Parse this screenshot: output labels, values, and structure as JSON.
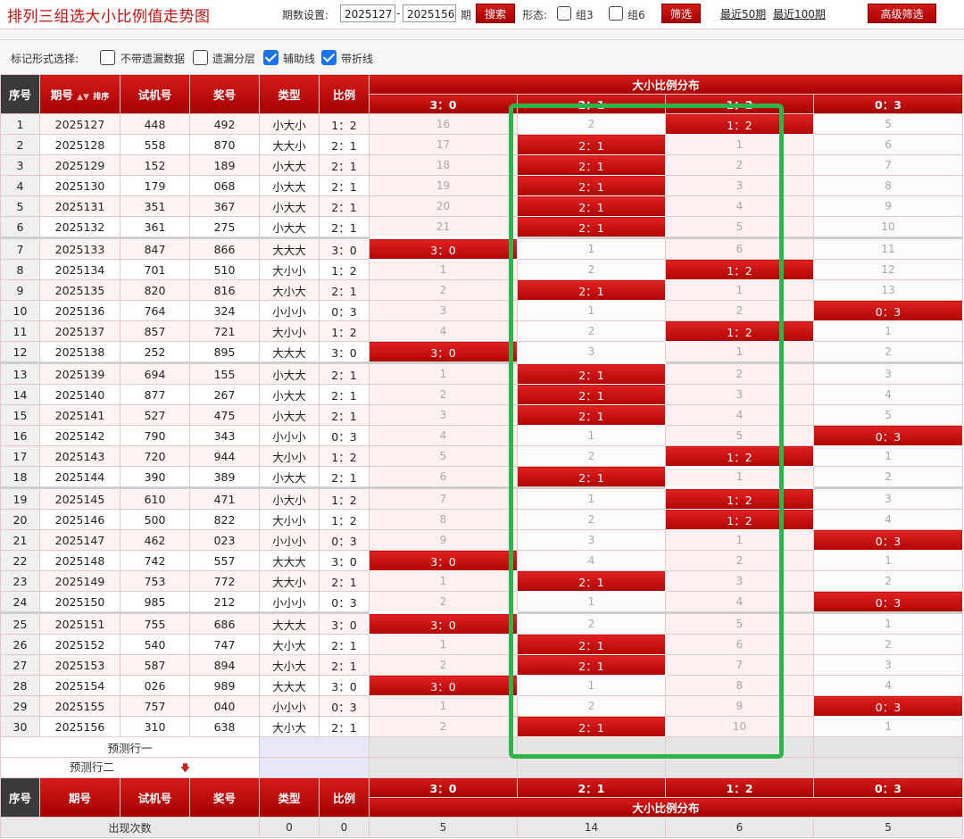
{
  "title": "排列三组选大小比例值走势图",
  "toolbar": {
    "period_label": "期数设置:",
    "start": "2025127",
    "dash": "-",
    "end": "2025156",
    "period_suffix": "期",
    "search": "搜索",
    "form_label": "形态:",
    "group3": "组3",
    "group6": "组6",
    "filter": "筛选",
    "recent50": "最近50期",
    "recent100": "最近100期",
    "advanced": "高级筛选"
  },
  "options": {
    "label": "标记形式选择:",
    "items": [
      {
        "label": "不带遗漏数据",
        "checked": false
      },
      {
        "label": "遗漏分层",
        "checked": false
      },
      {
        "label": "辅助线",
        "checked": true
      },
      {
        "label": "带折线",
        "checked": true
      }
    ]
  },
  "header": {
    "seq": "序号",
    "period": "期号",
    "sort_label": "排序",
    "trial": "试机号",
    "draw": "奖号",
    "type": "类型",
    "ratio": "比例",
    "dist": "大小比例分布",
    "cols": [
      "3：0",
      "2：1",
      "1：2",
      "0：3"
    ]
  },
  "rows": [
    {
      "seq": "1",
      "period": "2025127",
      "trial": "448",
      "draw": "492",
      "type": "小大小",
      "ratio": "1：2",
      "hit": 2,
      "cells": [
        "16",
        "2",
        "1：2",
        "5"
      ]
    },
    {
      "seq": "2",
      "period": "2025128",
      "trial": "558",
      "draw": "870",
      "type": "大大小",
      "ratio": "2：1",
      "hit": 1,
      "cells": [
        "17",
        "2：1",
        "1",
        "6"
      ]
    },
    {
      "seq": "3",
      "period": "2025129",
      "trial": "152",
      "draw": "189",
      "type": "小大大",
      "ratio": "2：1",
      "hit": 1,
      "cells": [
        "18",
        "2：1",
        "2",
        "7"
      ]
    },
    {
      "seq": "4",
      "period": "2025130",
      "trial": "179",
      "draw": "068",
      "type": "小大大",
      "ratio": "2：1",
      "hit": 1,
      "cells": [
        "19",
        "2：1",
        "3",
        "8"
      ]
    },
    {
      "seq": "5",
      "period": "2025131",
      "trial": "351",
      "draw": "367",
      "type": "小大大",
      "ratio": "2：1",
      "hit": 1,
      "cells": [
        "20",
        "2：1",
        "4",
        "9"
      ]
    },
    {
      "seq": "6",
      "period": "2025132",
      "trial": "361",
      "draw": "275",
      "type": "小大大",
      "ratio": "2：1",
      "hit": 1,
      "cells": [
        "21",
        "2：1",
        "5",
        "10"
      ]
    },
    {
      "seq": "7",
      "period": "2025133",
      "trial": "847",
      "draw": "866",
      "type": "大大大",
      "ratio": "3：0",
      "hit": 0,
      "cells": [
        "3：0",
        "1",
        "6",
        "11"
      ]
    },
    {
      "seq": "8",
      "period": "2025134",
      "trial": "701",
      "draw": "510",
      "type": "大小小",
      "ratio": "1：2",
      "hit": 2,
      "cells": [
        "1",
        "2",
        "1：2",
        "12"
      ]
    },
    {
      "seq": "9",
      "period": "2025135",
      "trial": "820",
      "draw": "816",
      "type": "大小大",
      "ratio": "2：1",
      "hit": 1,
      "cells": [
        "2",
        "2：1",
        "1",
        "13"
      ]
    },
    {
      "seq": "10",
      "period": "2025136",
      "trial": "764",
      "draw": "324",
      "type": "小小小",
      "ratio": "0：3",
      "hit": 3,
      "cells": [
        "3",
        "1",
        "2",
        "0：3"
      ]
    },
    {
      "seq": "11",
      "period": "2025137",
      "trial": "857",
      "draw": "721",
      "type": "大小小",
      "ratio": "1：2",
      "hit": 2,
      "cells": [
        "4",
        "2",
        "1：2",
        "1"
      ]
    },
    {
      "seq": "12",
      "period": "2025138",
      "trial": "252",
      "draw": "895",
      "type": "大大大",
      "ratio": "3：0",
      "hit": 0,
      "cells": [
        "3：0",
        "3",
        "1",
        "2"
      ]
    },
    {
      "seq": "13",
      "period": "2025139",
      "trial": "694",
      "draw": "155",
      "type": "小大大",
      "ratio": "2：1",
      "hit": 1,
      "cells": [
        "1",
        "2：1",
        "2",
        "3"
      ]
    },
    {
      "seq": "14",
      "period": "2025140",
      "trial": "877",
      "draw": "267",
      "type": "小大大",
      "ratio": "2：1",
      "hit": 1,
      "cells": [
        "2",
        "2：1",
        "3",
        "4"
      ]
    },
    {
      "seq": "15",
      "period": "2025141",
      "trial": "527",
      "draw": "475",
      "type": "小大大",
      "ratio": "2：1",
      "hit": 1,
      "cells": [
        "3",
        "2：1",
        "4",
        "5"
      ]
    },
    {
      "seq": "16",
      "period": "2025142",
      "trial": "790",
      "draw": "343",
      "type": "小小小",
      "ratio": "0：3",
      "hit": 3,
      "cells": [
        "4",
        "1",
        "5",
        "0：3"
      ]
    },
    {
      "seq": "17",
      "period": "2025143",
      "trial": "720",
      "draw": "944",
      "type": "大小小",
      "ratio": "1：2",
      "hit": 2,
      "cells": [
        "5",
        "2",
        "1：2",
        "1"
      ]
    },
    {
      "seq": "18",
      "period": "2025144",
      "trial": "390",
      "draw": "389",
      "type": "小大大",
      "ratio": "2：1",
      "hit": 1,
      "cells": [
        "6",
        "2：1",
        "1",
        "2"
      ]
    },
    {
      "seq": "19",
      "period": "2025145",
      "trial": "610",
      "draw": "471",
      "type": "小大小",
      "ratio": "1：2",
      "hit": 2,
      "cells": [
        "7",
        "1",
        "1：2",
        "3"
      ]
    },
    {
      "seq": "20",
      "period": "2025146",
      "trial": "500",
      "draw": "822",
      "type": "大小小",
      "ratio": "1：2",
      "hit": 2,
      "cells": [
        "8",
        "2",
        "1：2",
        "4"
      ]
    },
    {
      "seq": "21",
      "period": "2025147",
      "trial": "462",
      "draw": "023",
      "type": "小小小",
      "ratio": "0：3",
      "hit": 3,
      "cells": [
        "9",
        "3",
        "1",
        "0：3"
      ]
    },
    {
      "seq": "22",
      "period": "2025148",
      "trial": "742",
      "draw": "557",
      "type": "大大大",
      "ratio": "3：0",
      "hit": 0,
      "cells": [
        "3：0",
        "4",
        "2",
        "1"
      ]
    },
    {
      "seq": "23",
      "period": "2025149",
      "trial": "753",
      "draw": "772",
      "type": "大大小",
      "ratio": "2：1",
      "hit": 1,
      "cells": [
        "1",
        "2：1",
        "3",
        "2"
      ]
    },
    {
      "seq": "24",
      "period": "2025150",
      "trial": "985",
      "draw": "212",
      "type": "小小小",
      "ratio": "0：3",
      "hit": 3,
      "cells": [
        "2",
        "1",
        "4",
        "0：3"
      ]
    },
    {
      "seq": "25",
      "period": "2025151",
      "trial": "755",
      "draw": "686",
      "type": "大大大",
      "ratio": "3：0",
      "hit": 0,
      "cells": [
        "3：0",
        "2",
        "5",
        "1"
      ]
    },
    {
      "seq": "26",
      "period": "2025152",
      "trial": "540",
      "draw": "747",
      "type": "大小大",
      "ratio": "2：1",
      "hit": 1,
      "cells": [
        "1",
        "2：1",
        "6",
        "2"
      ]
    },
    {
      "seq": "27",
      "period": "2025153",
      "trial": "587",
      "draw": "894",
      "type": "大小大",
      "ratio": "2：1",
      "hit": 1,
      "cells": [
        "2",
        "2：1",
        "7",
        "3"
      ]
    },
    {
      "seq": "28",
      "period": "2025154",
      "trial": "026",
      "draw": "989",
      "type": "大大大",
      "ratio": "3：0",
      "hit": 0,
      "cells": [
        "3：0",
        "1",
        "8",
        "4"
      ]
    },
    {
      "seq": "29",
      "period": "2025155",
      "trial": "757",
      "draw": "040",
      "type": "小小小",
      "ratio": "0：3",
      "hit": 3,
      "cells": [
        "1",
        "2",
        "9",
        "0：3"
      ]
    },
    {
      "seq": "30",
      "period": "2025156",
      "trial": "310",
      "draw": "638",
      "type": "大小大",
      "ratio": "2：1",
      "hit": 1,
      "cells": [
        "2",
        "2：1",
        "10",
        "1"
      ]
    }
  ],
  "predict": [
    "预测行一",
    "预测行二"
  ],
  "footer": {
    "label": "出现次数",
    "type_count": "0",
    "ratio_count": "0",
    "counts": [
      "5",
      "14",
      "6",
      "5"
    ]
  },
  "colors": {
    "accent": "#c40000",
    "highlight_box": "#2db44a"
  }
}
